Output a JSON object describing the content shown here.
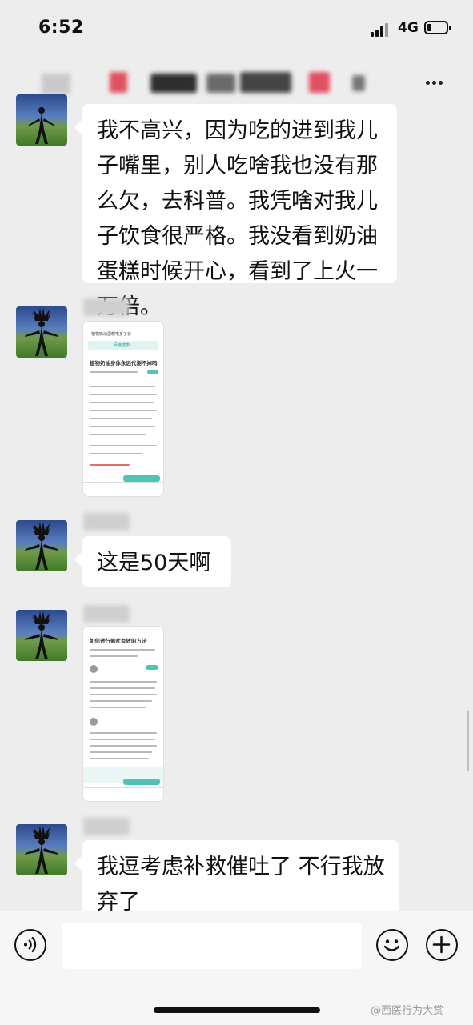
{
  "status_bar": {
    "time": "6:52",
    "network": "4G"
  },
  "chat_title": {
    "name_redacted": true
  },
  "messages": [
    {
      "kind": "text",
      "text": "我不高兴，因为吃的进到我儿子嘴里，别人吃啥我也没有那么欠，去科普。我凭啥对我儿子饮食很严格。我没看到奶油蛋糕时候开心，看到了上火一万倍。"
    },
    {
      "kind": "image",
      "caption": "植物奶油身体永远代谢不掉吗"
    },
    {
      "kind": "text",
      "text": "这是50天啊"
    },
    {
      "kind": "image",
      "caption": "如何进行催吐有效的方法"
    },
    {
      "kind": "text",
      "text": "我逗考虑补救催吐了 不行我放弃了"
    }
  ],
  "thumb1": {
    "search": "植物奶油蛋糕吃多了会",
    "app": "百度健康",
    "title": "植物奶油身体永远代谢不掉吗"
  },
  "thumb2": {
    "title": "如何进行催吐有效的方法"
  },
  "watermark": "@西医行为大赏",
  "icons": {
    "voice": "voice-icon",
    "emoji": "emoji-icon",
    "more": "plus-icon"
  },
  "colors": {
    "background": "#ededed",
    "bubble": "#ffffff",
    "accent": "#4fc3b8"
  }
}
